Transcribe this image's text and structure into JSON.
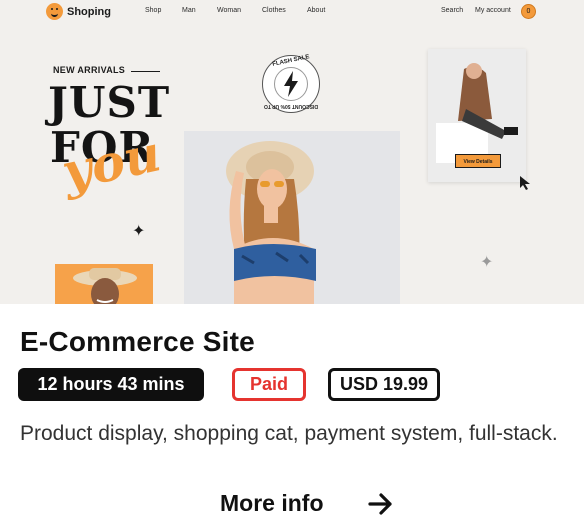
{
  "preview": {
    "site": {
      "logo_text": "Shoping",
      "nav_links": [
        "Shop",
        "Man",
        "Woman",
        "Clothes",
        "About"
      ],
      "nav_right": [
        "Search",
        "My account"
      ],
      "cart_count": "0"
    },
    "hero": {
      "kicker": "NEW ARRIVALS",
      "line1": "JUST",
      "line2": "FOR",
      "script": "you"
    },
    "badge": {
      "top_text": "FLASH SALE",
      "bottom_text": "DISCOUNT 50% UP TO"
    },
    "product_button": "View Details",
    "colors": {
      "accent": "#f39a3b",
      "background": "#f2f0ed"
    }
  },
  "card": {
    "title": "E-Commerce Site",
    "duration": "12 hours 43 mins",
    "status": "Paid",
    "price": "USD 19.99",
    "description": "Product display, shopping cat, payment system, full-stack.",
    "cta_label": "More info",
    "cta_icon": "arrow-right-icon",
    "colors": {
      "status": "#e5342f",
      "text": "#111111"
    }
  }
}
